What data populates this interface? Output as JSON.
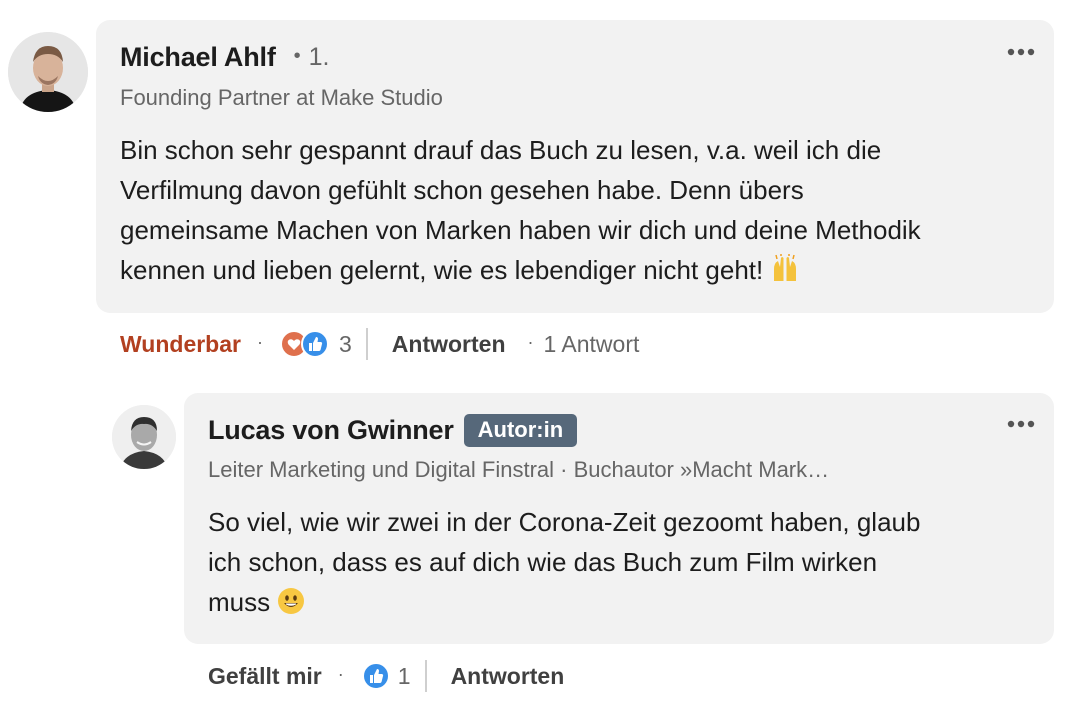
{
  "comments": [
    {
      "author": "Michael Ahlf",
      "degree": "1.",
      "degree_dot": "•",
      "headline": "Founding Partner at Make Studio",
      "text_lines": [
        "Bin schon sehr gespannt drauf das Buch zu lesen, v.a. weil ich die",
        "Verfilmung davon gefühlt schon gesehen habe. Denn übers",
        "gemeinsame Machen von Marken haben wir dich und deine Methodik",
        "kennen und lieben gelernt, wie es lebendiger nicht geht!"
      ],
      "emoji": "raising-hands-icon",
      "reaction_label": "Wunderbar",
      "reaction_count": "3",
      "reply_label": "Antworten",
      "replies_info": "1 Antwort",
      "sep": "·"
    },
    {
      "author": "Lucas von Gwinner",
      "badge": "Autor:in",
      "headline": "Leiter Marketing und Digital Finstral · Buchautor »Macht Mark…",
      "text_lines": [
        "So viel, wie wir zwei in der Corona-Zeit gezoomt haben, glaub",
        "ich schon, dass es auf dich wie das Buch zum Film wirken",
        "muss"
      ],
      "emoji": "smiley-icon",
      "reaction_label": "Gefällt mir",
      "reaction_count": "1",
      "reply_label": "Antworten",
      "sep": "·"
    }
  ],
  "colors": {
    "bubble": "#f2f2f2",
    "badge": "#56687a",
    "active_reaction": "#b24020",
    "like_blue": "#378fe9",
    "love_red": "#df704d"
  }
}
